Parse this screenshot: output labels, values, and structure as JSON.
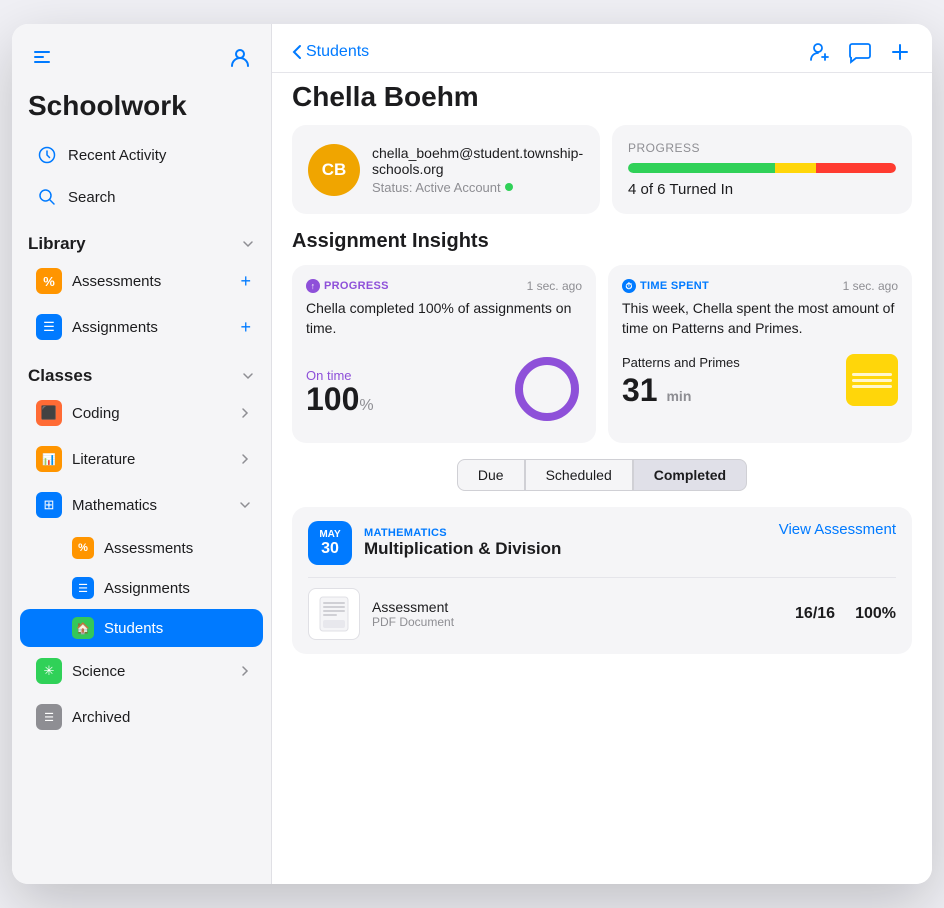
{
  "app": {
    "title": "Schoolwork",
    "window_icon": "sidebar-icon"
  },
  "sidebar": {
    "top_icons": {
      "sidebar_toggle": "⊞",
      "profile": "👤"
    },
    "nav_items": [
      {
        "id": "recent-activity",
        "label": "Recent Activity",
        "icon": "🕐",
        "icon_color": "#007aff"
      },
      {
        "id": "search",
        "label": "Search",
        "icon": "🔍",
        "icon_color": "#007aff"
      }
    ],
    "library": {
      "title": "Library",
      "items": [
        {
          "id": "assessments",
          "label": "Assessments",
          "icon": "✦",
          "icon_bg": "#ff9500",
          "has_add": true
        },
        {
          "id": "assignments",
          "label": "Assignments",
          "icon": "☰",
          "icon_bg": "#007aff",
          "has_add": true
        }
      ]
    },
    "classes": {
      "title": "Classes",
      "items": [
        {
          "id": "coding",
          "label": "Coding",
          "icon": "⬛",
          "icon_bg": "#ff9500",
          "has_chevron": true,
          "expanded": false
        },
        {
          "id": "literature",
          "label": "Literature",
          "icon": "📊",
          "icon_bg": "#ff9500",
          "has_chevron": true,
          "expanded": false
        },
        {
          "id": "mathematics",
          "label": "Mathematics",
          "icon": "⊞",
          "icon_bg": "#007aff",
          "has_chevron": true,
          "expanded": true
        }
      ],
      "mathematics_sub": [
        {
          "id": "math-assessments",
          "label": "Assessments",
          "icon": "✦",
          "icon_bg": "#ff9500"
        },
        {
          "id": "math-assignments",
          "label": "Assignments",
          "icon": "☰",
          "icon_bg": "#007aff"
        },
        {
          "id": "math-students",
          "label": "Students",
          "icon": "🏠",
          "icon_bg": "#34c759",
          "active": true
        }
      ],
      "more_items": [
        {
          "id": "science",
          "label": "Science",
          "icon": "✳",
          "icon_bg": "#30d158",
          "has_chevron": true
        }
      ]
    },
    "archived": {
      "label": "Archived",
      "icon": "☰",
      "icon_bg": "#8e8e93"
    }
  },
  "main": {
    "back_label": "Students",
    "student_name": "Chella Boehm",
    "header_actions": {
      "add_student": "add-student-icon",
      "message": "message-icon",
      "add": "add-icon"
    },
    "profile_card": {
      "avatar_initials": "CB",
      "avatar_bg": "#f0a500",
      "email": "chella_boehm@student.township-schools.org",
      "status_label": "Status: Active Account"
    },
    "progress_card": {
      "label": "PROGRESS",
      "bar_green_pct": 55,
      "bar_yellow_pct": 15,
      "bar_red_pct": 30,
      "text": "4 of 6 Turned In"
    },
    "insights": {
      "heading": "Assignment Insights",
      "progress_card": {
        "badge": "PROGRESS",
        "timestamp": "1 sec. ago",
        "description": "Chella completed 100% of assignments on time.",
        "metric_label": "On time",
        "metric_value": "100",
        "metric_unit": "%",
        "donut_pct": 100,
        "donut_color": "#8e50d9"
      },
      "time_card": {
        "badge": "TIME SPENT",
        "timestamp": "1 sec. ago",
        "description": "This week, Chella spent the most amount of time on Patterns and Primes.",
        "subject": "Patterns and Primes",
        "metric_value": "31",
        "metric_unit": "min"
      }
    },
    "tabs": [
      {
        "id": "due",
        "label": "Due",
        "active": false
      },
      {
        "id": "scheduled",
        "label": "Scheduled",
        "active": false
      },
      {
        "id": "completed",
        "label": "Completed",
        "active": true
      }
    ],
    "assignments": [
      {
        "month": "MAY",
        "day": "30",
        "class": "MATHEMATICS",
        "title": "Multiplication & Division",
        "action_label": "View Assessment",
        "doc_title": "Assessment",
        "doc_type": "PDF Document",
        "score": "16/16",
        "percent": "100%"
      }
    ]
  }
}
